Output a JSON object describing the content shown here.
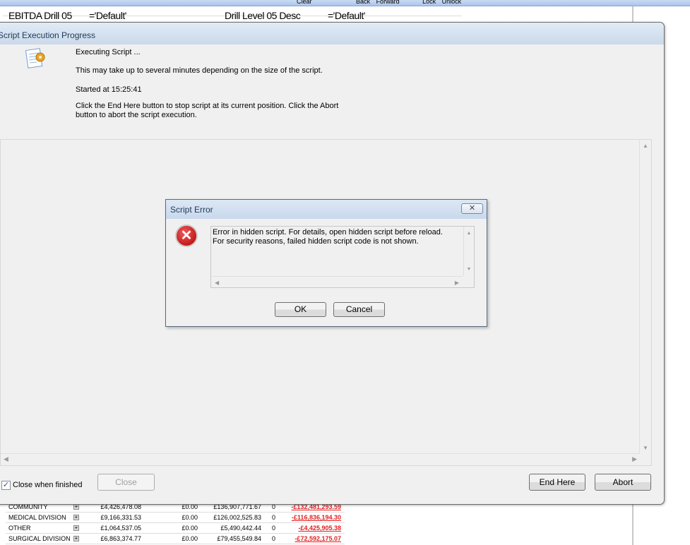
{
  "toolbar": {
    "items": [
      "Clear",
      "Back",
      "Forward",
      "Lock",
      "Unlock"
    ]
  },
  "variables": [
    {
      "name": "EBITDA Drill 05",
      "value": "='Default'"
    },
    {
      "name": "Drill Level 05 Desc",
      "value": "='Default'"
    }
  ],
  "progress_dialog": {
    "title": "Script Execution Progress",
    "line1": "Executing Script ...",
    "line2": "This may take up to several minutes depending on the size of the script.",
    "started": "Started at 15:25:41",
    "line4a": "Click the End Here button to stop script at its current position. Click the Abort",
    "line4b": "button to abort the script execution.",
    "close_when_finished_label": "Close when finished",
    "close_when_finished_checked": true,
    "close_label": "Close",
    "end_here_label": "End Here",
    "abort_label": "Abort"
  },
  "error_dialog": {
    "title": "Script Error",
    "close_icon": "✕",
    "message_line1": "Error in hidden script. For details, open hidden script before reload.",
    "message_line2": "For security reasons, failed hidden script code is not shown.",
    "ok_label": "OK",
    "cancel_label": "Cancel"
  },
  "table": {
    "rows": [
      {
        "name": "COMMUNITY",
        "c1": "£4,426,478.08",
        "c2": "£0.00",
        "c3": "£136,907,771.67",
        "c4": "0",
        "c5": "-£132,481,293.59"
      },
      {
        "name": "MEDICAL DIVISION",
        "c1": "£9,166,331.53",
        "c2": "£0.00",
        "c3": "£126,002,525.83",
        "c4": "0",
        "c5": "-£116,836,194.30"
      },
      {
        "name": "OTHER",
        "c1": "£1,064,537.05",
        "c2": "£0.00",
        "c3": "£5,490,442.44",
        "c4": "0",
        "c5": "-£4,425,905.38"
      },
      {
        "name": "SURGICAL DIVISION",
        "c1": "£6,863,374.77",
        "c2": "£0.00",
        "c3": "£79,455,549.84",
        "c4": "0",
        "c5": "-£72,592,175.07"
      }
    ]
  }
}
